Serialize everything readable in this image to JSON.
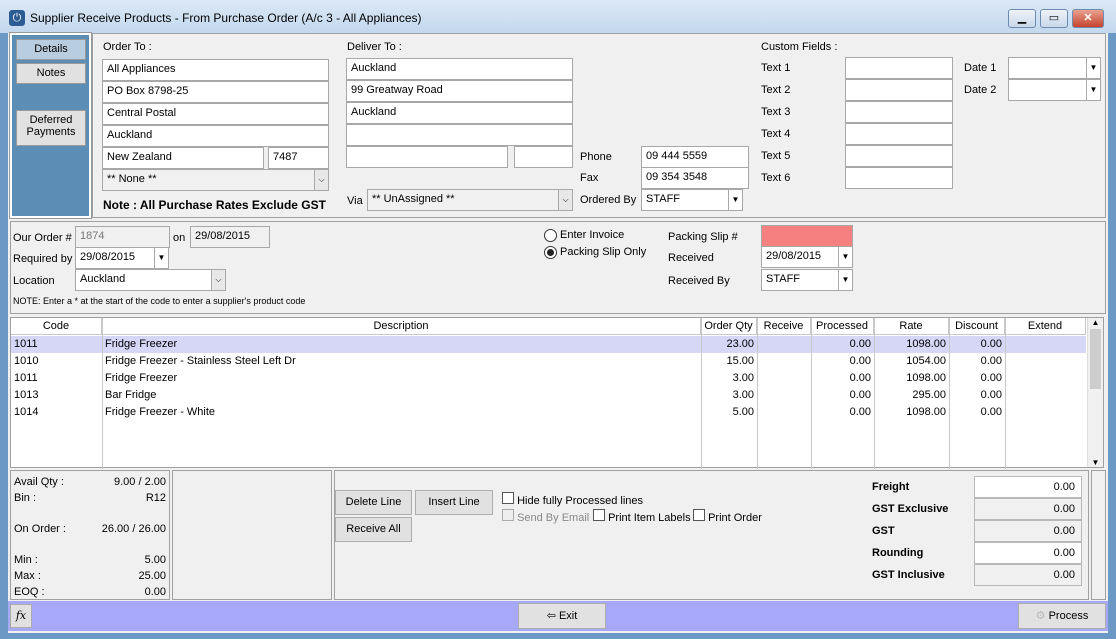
{
  "window": {
    "title": "Supplier Receive Products - From Purchase Order (A/c 3 - All Appliances)",
    "minimize": "▁",
    "maximize": "▭",
    "close": "✕"
  },
  "sidebar": {
    "details": "Details",
    "notes": "Notes",
    "deferred": "Deferred Payments"
  },
  "order_to": {
    "label": "Order To  :",
    "lines": [
      "All Appliances",
      "PO Box 8798-25",
      "Central Postal",
      "Auckland"
    ],
    "country": "New Zealand",
    "postcode": "7487",
    "select": "** None **",
    "note": "Note : All Purchase Rates Exclude GST"
  },
  "deliver_to": {
    "label": "Deliver To :",
    "lines": [
      "Auckland",
      "99 Greatway Road",
      "Auckland",
      ""
    ],
    "via_label": "Via",
    "via": "** UnAssigned **"
  },
  "contact": {
    "phone_label": "Phone",
    "phone": "09 444 5559",
    "fax_label": "Fax",
    "fax": "09 354 3548",
    "ordered_by_label": "Ordered By",
    "ordered_by": "STAFF"
  },
  "custom": {
    "label": "Custom Fields  :",
    "texts": [
      "Text 1",
      "Text 2",
      "Text 3",
      "Text 4",
      "Text 5",
      "Text 6"
    ],
    "date1": "Date 1",
    "date2": "Date 2"
  },
  "order": {
    "our_order_label": "Our Order #",
    "our_order": "1874",
    "on_label": "on",
    "on_date": "29/08/2015",
    "required_label": "Required by",
    "required": "29/08/2015",
    "location_label": "Location",
    "location": "Auckland",
    "note": "NOTE: Enter a * at the start of the code to enter a supplier's product code",
    "enter_invoice": "Enter Invoice",
    "packing_only": "Packing Slip Only",
    "mode": "Packing Slip Only",
    "packing_label": "Packing Slip #",
    "packing_value": "",
    "packing_color": "#f58080",
    "received_label": "Received",
    "received": "29/08/2015",
    "received_by_label": "Received By",
    "received_by": "STAFF"
  },
  "grid": {
    "headers": [
      "Code",
      "Description",
      "Order Qty",
      "Receive",
      "Processed",
      "Rate",
      "Discount",
      "Extend"
    ],
    "rows": [
      [
        "1011",
        "Fridge Freezer",
        "23.00",
        "",
        "0.00",
        "1098.00",
        "0.00",
        ""
      ],
      [
        "1010",
        "Fridge Freezer - Stainless Steel Left Dr",
        "15.00",
        "",
        "0.00",
        "1054.00",
        "0.00",
        ""
      ],
      [
        "1011",
        "Fridge Freezer",
        "3.00",
        "",
        "0.00",
        "1098.00",
        "0.00",
        ""
      ],
      [
        "1013",
        "Bar Fridge",
        "3.00",
        "",
        "0.00",
        "295.00",
        "0.00",
        ""
      ],
      [
        "1014",
        "Fridge Freezer - White",
        "5.00",
        "",
        "0.00",
        "1098.00",
        "0.00",
        ""
      ]
    ],
    "selected_color": "#d6d6f6"
  },
  "stock": {
    "avail_label": "Avail Qty :",
    "avail": "9.00 / 2.00",
    "bin_label": "Bin :",
    "bin": "R12",
    "on_order_label": "On Order :",
    "on_order": "26.00 / 26.00",
    "min_label": "Min :",
    "min": "5.00",
    "max_label": "Max :",
    "max": "25.00",
    "eoq_label": "EOQ :",
    "eoq": "0.00"
  },
  "actions": {
    "delete": "Delete Line",
    "insert": "Insert Line",
    "receive_all": "Receive All",
    "hide": "Hide fully Processed lines",
    "email": "Send By Email",
    "labels": "Print Item Labels",
    "print": "Print Order"
  },
  "totals": [
    {
      "label": "Freight",
      "value": "0.00"
    },
    {
      "label": "GST Exclusive",
      "value": "0.00"
    },
    {
      "label": "GST",
      "value": "0.00"
    },
    {
      "label": "Rounding",
      "value": "0.00"
    },
    {
      "label": "GST Inclusive",
      "value": "0.00"
    }
  ],
  "footer": {
    "fx": "fx",
    "exit": "Exit",
    "process": "Process"
  }
}
